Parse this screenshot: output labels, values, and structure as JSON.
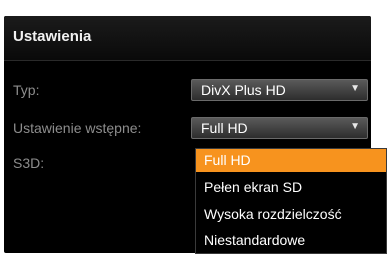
{
  "panel": {
    "title": "Ustawienia"
  },
  "settings": {
    "type_label": "Typ:",
    "type_value": "DivX Plus HD",
    "preset_label": "Ustawienie wstępne:",
    "preset_value": "Full HD",
    "s3d_label": "S3D:"
  },
  "dropdown": {
    "options": [
      {
        "label": "Full HD",
        "selected": true
      },
      {
        "label": "Pełen ekran SD",
        "selected": false
      },
      {
        "label": "Wysoka rozdzielczość",
        "selected": false
      },
      {
        "label": "Niestandardowe",
        "selected": false
      }
    ]
  },
  "icons": {
    "dropdown_arrow": "▼"
  },
  "colors": {
    "accent": "#f7931e",
    "panel_bg": "#000000"
  }
}
